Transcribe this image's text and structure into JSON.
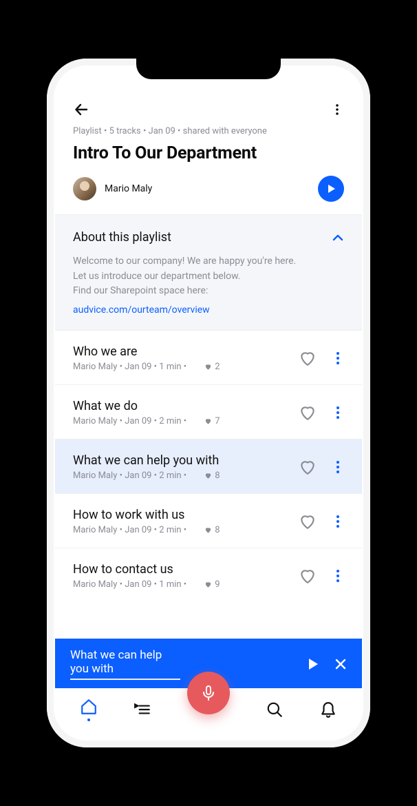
{
  "meta": {
    "line": "Playlist • 5 tracks • Jan 09 • shared with everyone",
    "title": "Intro To Our Department"
  },
  "author": {
    "name": "Mario Maly"
  },
  "about": {
    "heading": "About this playlist",
    "body": "Welcome to our company! We are happy you're here.\nLet us introduce our department below.\nFind our Sharepoint space here:",
    "link": "audvice.com/ourteam/overview"
  },
  "tracks": [
    {
      "title": "Who we are",
      "author": "Mario Maly",
      "date": "Jan 09",
      "duration": "1 min",
      "likes": 2,
      "selected": false
    },
    {
      "title": "What we do",
      "author": "Mario Maly",
      "date": "Jan 09",
      "duration": "2 min",
      "likes": 7,
      "selected": false
    },
    {
      "title": "What we can help you with",
      "author": "Mario Maly",
      "date": "Jan 09",
      "duration": "2 min",
      "likes": 8,
      "selected": true
    },
    {
      "title": "How to work with us",
      "author": "Mario Maly",
      "date": "Jan 09",
      "duration": "2 min",
      "likes": 8,
      "selected": false
    },
    {
      "title": "How to contact us",
      "author": "Mario Maly",
      "date": "Jan 09",
      "duration": "1 min",
      "likes": 9,
      "selected": false
    }
  ],
  "now_playing": {
    "title": "What we can help you with"
  },
  "colors": {
    "accent": "#0b5fff",
    "muted": "#8a8c93",
    "panel": "#f5f6f9",
    "selected": "#e7eefc",
    "record": "#e65a5d"
  }
}
